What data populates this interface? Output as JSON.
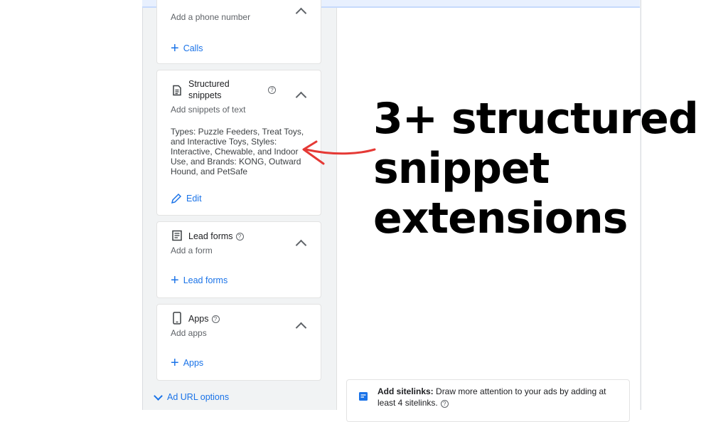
{
  "calls": {
    "subtitle": "Add a phone number",
    "action": "Calls"
  },
  "structured_snippets": {
    "title": "Structured snippets",
    "subtitle": "Add snippets of text",
    "body": "Types: Puzzle Feeders, Treat Toys, and Interactive Toys, Styles: Interactive, Chewable, and Indoor Use, and Brands: KONG, Outward Hound, and PetSafe",
    "action": "Edit"
  },
  "lead_forms": {
    "title": "Lead forms",
    "subtitle": "Add a form",
    "action": "Lead forms"
  },
  "apps": {
    "title": "Apps",
    "subtitle": "Add apps",
    "action": "Apps"
  },
  "ad_url_options": "Ad URL options",
  "sitelinks": {
    "bold": "Add sitelinks:",
    "text": " Draw more attention to your ads by adding at least 4 sitelinks."
  },
  "help_glyph": "?",
  "annotation": {
    "line1": "3+ structured",
    "line2": "snippet",
    "line3": "extensions"
  },
  "colors": {
    "accent": "#1a73e8",
    "arrow": "#e53935"
  }
}
